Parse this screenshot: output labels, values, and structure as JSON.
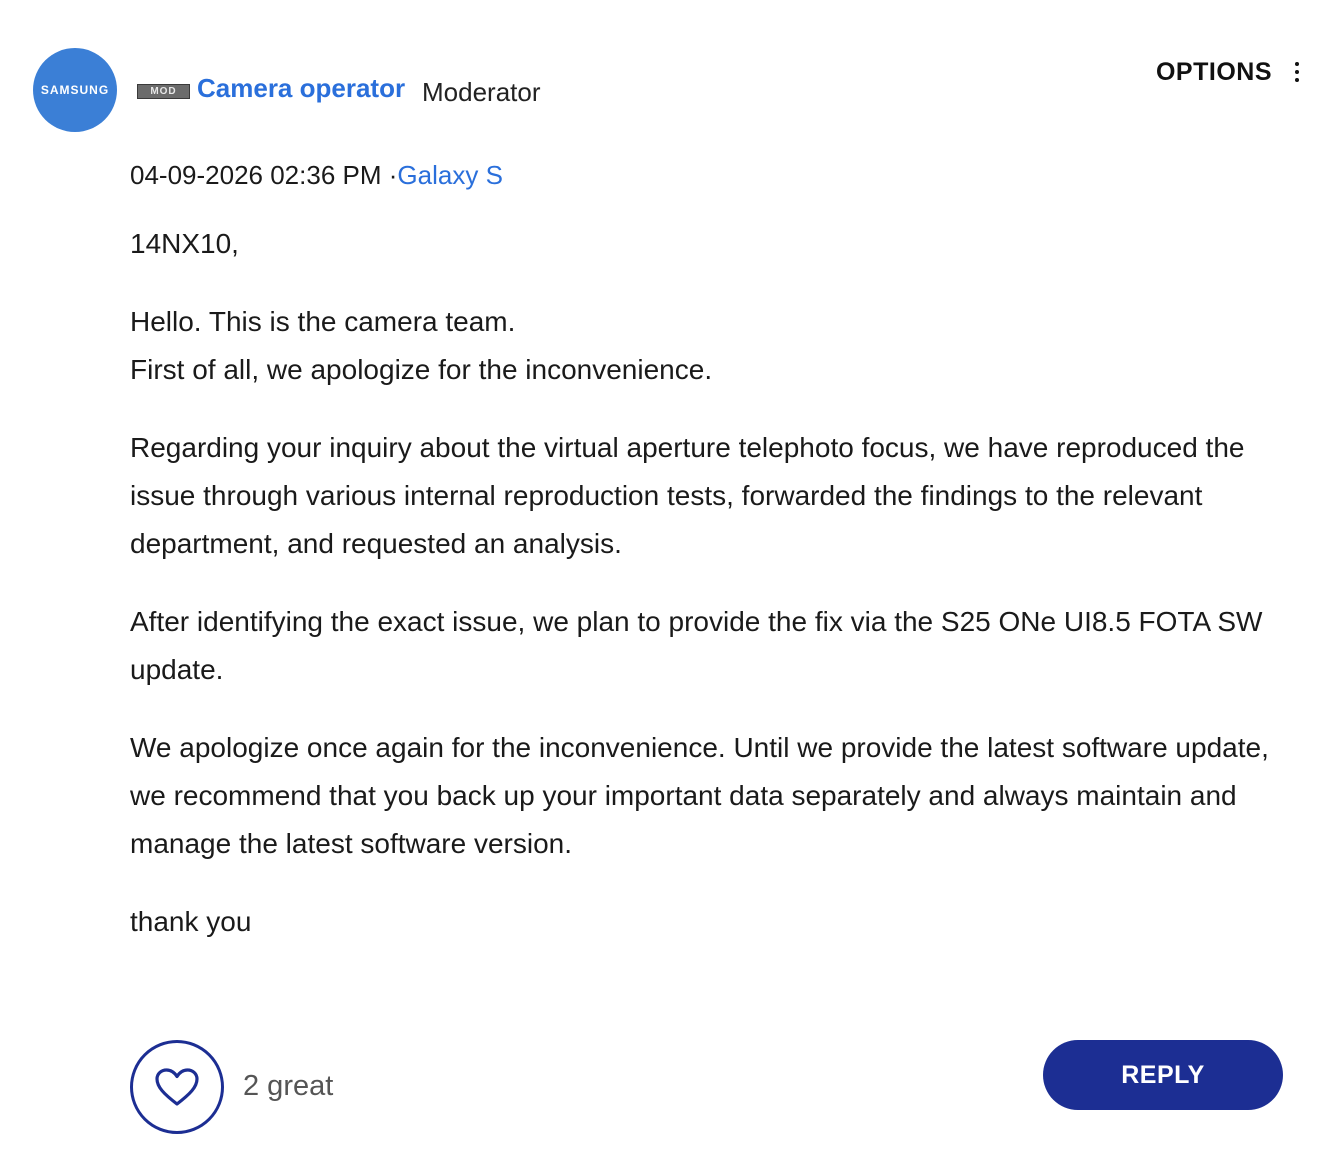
{
  "author": {
    "avatar_logo": "SAMSUNG",
    "badge": "MOD",
    "name": "Camera operator",
    "role": "Moderator"
  },
  "options": {
    "label": "OPTIONS",
    "icon": "kebab-icon"
  },
  "meta": {
    "timestamp": "04-09-2026 02:36 PM",
    "separator": "·",
    "board": "Galaxy S"
  },
  "post": {
    "paragraphs": [
      "14NX10,",
      "Hello. This is the camera team.\nFirst of all, we apologize for the inconvenience.",
      "Regarding your inquiry about the virtual aperture telephoto focus, we have reproduced the issue through various internal reproduction tests, forwarded the findings to the relevant department, and requested an analysis.",
      "After identifying the exact issue, we plan to provide the fix via the S25 ONe UI8.5 FOTA SW update.",
      "We apologize once again for the inconvenience. Until we provide the latest software update, we recommend that you back up your important data separately and always maintain and manage the latest software version.",
      "thank you"
    ]
  },
  "footer": {
    "like_icon": "heart-icon",
    "like_count": "2 great",
    "reply_label": "REPLY"
  },
  "colors": {
    "avatar_bg": "#3b7fd6",
    "link": "#2a6fdb",
    "primary": "#1c2e93"
  }
}
